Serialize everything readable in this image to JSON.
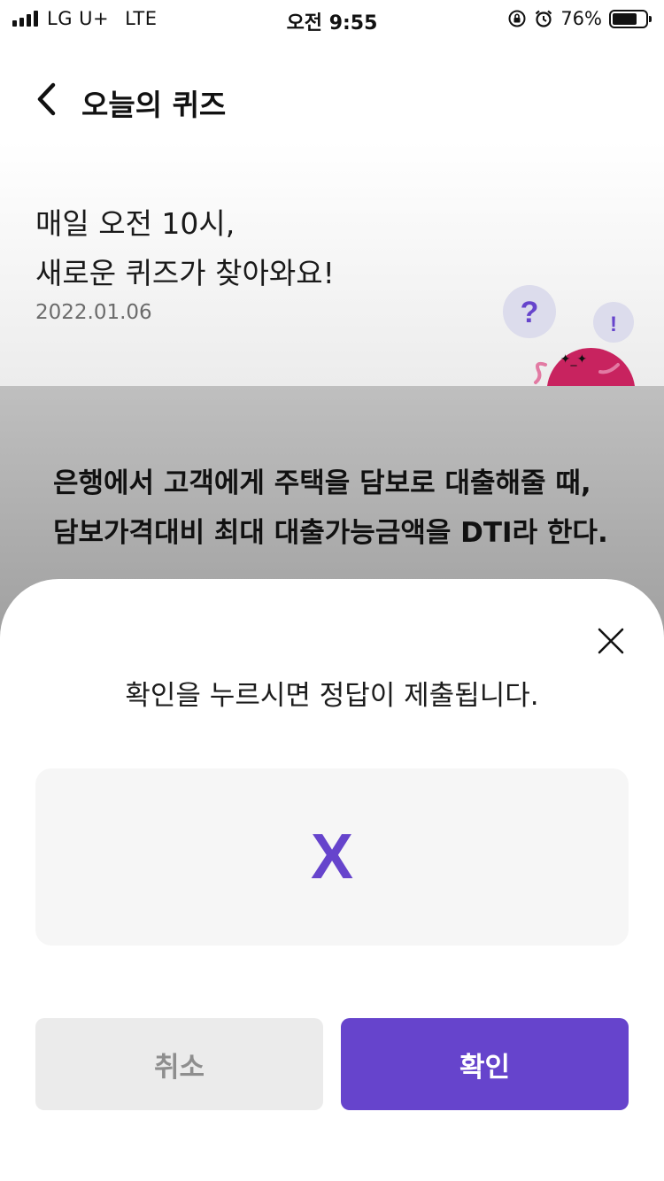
{
  "status_bar": {
    "carrier": "LG U+",
    "network": "LTE",
    "time": "오전 9:55",
    "battery_percent": "76%",
    "battery_level": 0.76
  },
  "header": {
    "title": "오늘의 퀴즈"
  },
  "hero": {
    "line1": "매일 오전 10시,",
    "line2": "새로운 퀴즈가 찾아와요!",
    "date": "2022.01.06",
    "bubble_question": "?",
    "bubble_exclaim": "!"
  },
  "question": {
    "text": "은행에서 고객에게 주택을 담보로 대출해줄 때, 담보가격대비 최대 대출가능금액을 DTI라 한다."
  },
  "sheet": {
    "message": "확인을 누르시면 정답이 제출됩니다.",
    "selected_answer": "X",
    "cancel_label": "취소",
    "confirm_label": "확인"
  },
  "colors": {
    "accent": "#6644cc",
    "mascot": "#c8235f",
    "cancel_bg": "#ebebeb"
  }
}
